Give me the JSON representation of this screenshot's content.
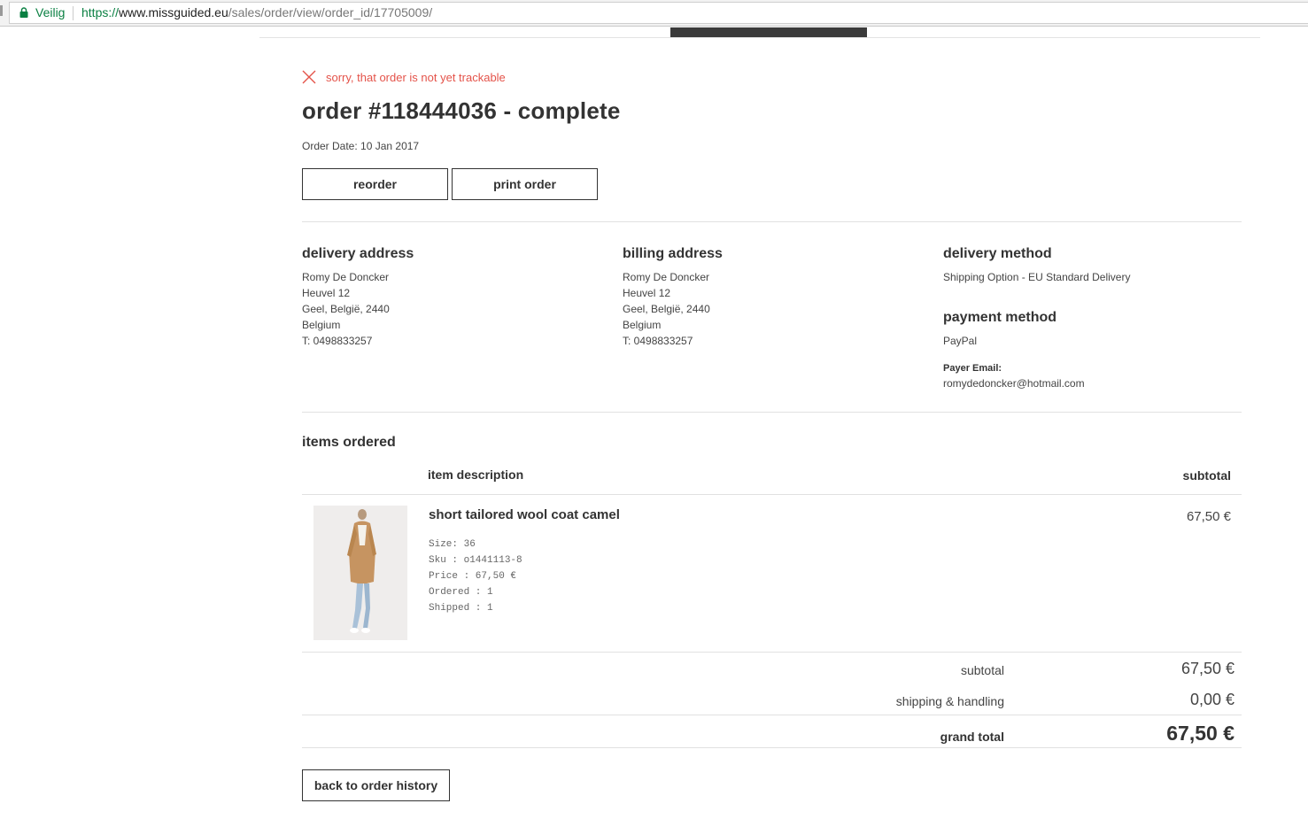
{
  "browser": {
    "secure_label": "Veilig",
    "url_protocol": "https://",
    "url_host": "www.missguided.eu",
    "url_path": "/sales/order/view/order_id/17705009/"
  },
  "notice": {
    "message": "sorry, that order is not yet trackable",
    "color": "#e4534a"
  },
  "order": {
    "title": "order #118444036 - complete",
    "date_label": "Order Date:",
    "date": "10 Jan 2017",
    "reorder_label": "reorder",
    "print_label": "print order"
  },
  "delivery_address": {
    "heading": "delivery address",
    "lines": [
      "Romy De Doncker",
      "Heuvel 12",
      "Geel, België, 2440",
      "Belgium",
      "T: 0498833257"
    ]
  },
  "billing_address": {
    "heading": "billing address",
    "lines": [
      "Romy De Doncker",
      "Heuvel 12",
      "Geel, België, 2440",
      "Belgium",
      "T: 0498833257"
    ]
  },
  "delivery_method": {
    "heading": "delivery method",
    "value": "Shipping Option - EU Standard Delivery"
  },
  "payment_method": {
    "heading": "payment method",
    "value": "PayPal",
    "payer_label": "Payer Email:",
    "payer_email": "romydedoncker@hotmail.com"
  },
  "items": {
    "heading": "items ordered",
    "col_description": "item description",
    "col_subtotal": "subtotal",
    "rows": [
      {
        "name": "short tailored wool coat camel",
        "size": "Size: 36",
        "sku": "Sku : o1441113-8",
        "price": "Price : 67,50 €",
        "ordered": "Ordered : 1",
        "shipped": "Shipped : 1",
        "subtotal": "67,50 €"
      }
    ]
  },
  "totals": {
    "subtotal_label": "subtotal",
    "subtotal_value": "67,50 €",
    "shipping_label": "shipping & handling",
    "shipping_value": "0,00 €",
    "grand_label": "grand total",
    "grand_value": "67,50 €"
  },
  "footer": {
    "back_label": "back to order history"
  }
}
